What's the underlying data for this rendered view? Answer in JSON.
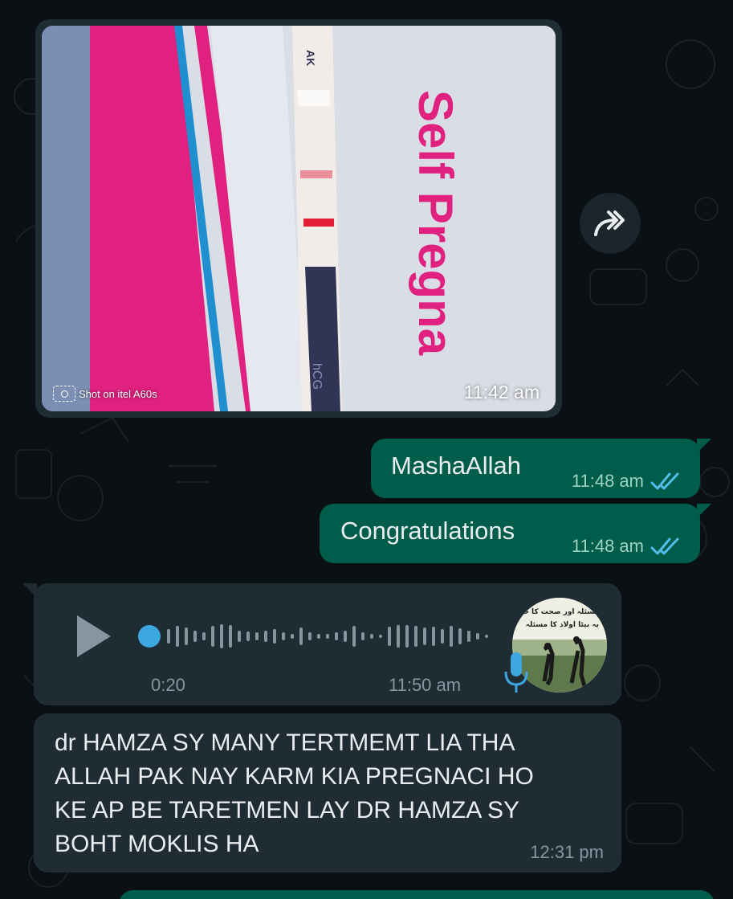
{
  "image_message": {
    "photo_text": "Self Pregna",
    "strip_label_top": "AK",
    "strip_label_bottom": "hCG",
    "watermark": "Shot on itel A60s",
    "time": "11:42 am",
    "forward_icon": "forward-icon"
  },
  "outgoing": [
    {
      "text": "MashaAllah",
      "time": "11:48 am",
      "status_icon": "double-check-icon"
    },
    {
      "text": "Congratulations",
      "time": "11:48 am",
      "status_icon": "double-check-icon"
    }
  ],
  "voice_message": {
    "duration": "0:20",
    "time": "11:50 am",
    "progress": 0,
    "avatar_caption_line1": "مسئلہ اور صحت کا حل",
    "avatar_caption_line2": "یہ بیٹا اولاد کا مسئلہ"
  },
  "incoming_text": {
    "text": "dr HAMZA SY MANY TERTMEMT LIA THA\nALLAH PAK NAY KARM KIA PREGNACI HO\nKE AP BE TARETMEN LAY DR HAMZA SY\nBOHT MOKLIS HA",
    "time": "12:31 pm"
  },
  "colors": {
    "background": "#0b1014",
    "incoming_bubble": "#1f2c34",
    "outgoing_bubble": "#005c4b",
    "read_tick": "#53bdeb",
    "timestamp": "#8696a0"
  }
}
